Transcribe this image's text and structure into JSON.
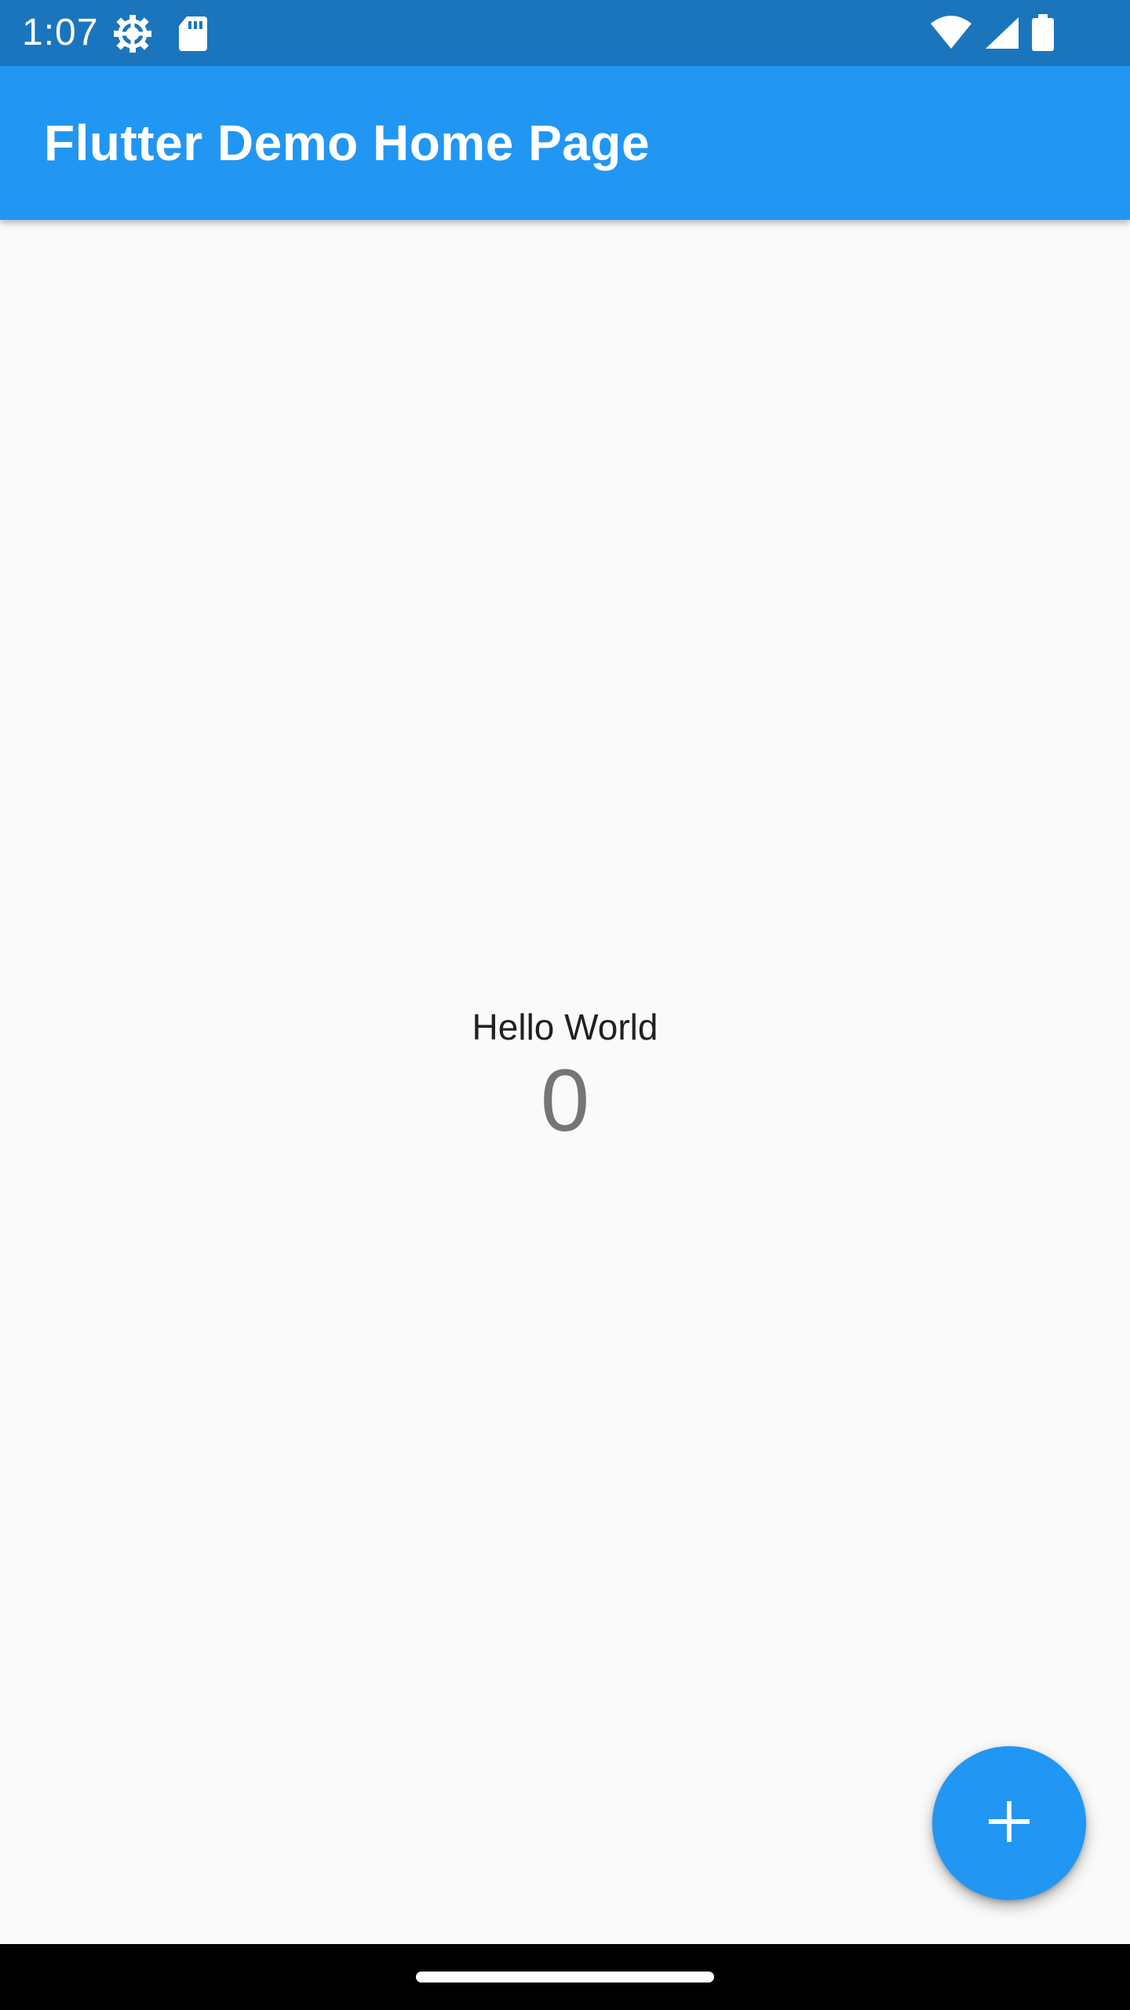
{
  "status_bar": {
    "time": "1:07",
    "left_icons": [
      "settings-gear-icon",
      "sd-card-icon"
    ],
    "right_icons": [
      "wifi-icon",
      "cellular-signal-icon",
      "battery-icon"
    ],
    "background_color": "#1B75BC"
  },
  "app_bar": {
    "title": "Flutter Demo Home Page",
    "background_color": "#2196F3"
  },
  "main": {
    "greeting": "Hello World",
    "counter_value": "0"
  },
  "fab": {
    "icon": "add-icon",
    "background_color": "#2196F3"
  },
  "nav_bar": {
    "handle": "gesture-handle"
  }
}
